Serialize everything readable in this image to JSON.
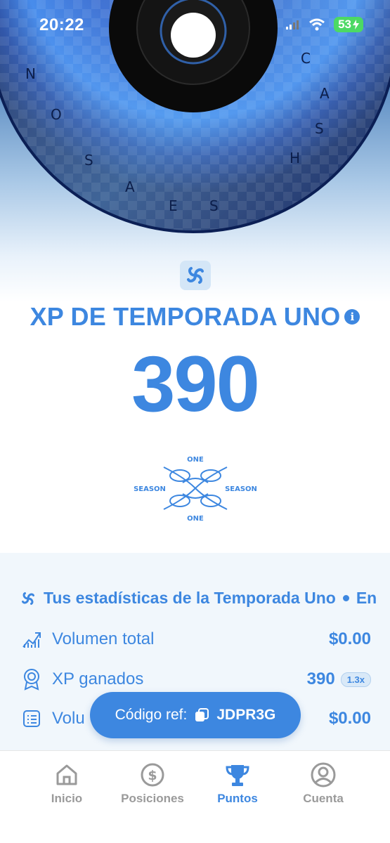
{
  "status_bar": {
    "time": "20:22",
    "battery": "53"
  },
  "disc": {
    "letters": [
      "C",
      "A",
      "S",
      "H",
      "S",
      "E",
      "A",
      "S",
      "O",
      "N"
    ]
  },
  "season": {
    "title": "XP DE TEMPORADA UNO",
    "xp_value": "390",
    "logo_words": {
      "top": "ONE",
      "bottom": "ONE",
      "left": "SEASON",
      "right": "SEASON"
    }
  },
  "stats": {
    "ticker_text": "Tus estadísticas de la Temporada Uno",
    "ticker_tail": "En",
    "rows": [
      {
        "label": "Volumen total",
        "value": "$0.00"
      },
      {
        "label": "XP ganados",
        "value": "390",
        "badge": "1.3x"
      },
      {
        "label": "Volu",
        "value": "$0.00"
      }
    ]
  },
  "referral": {
    "label": "Código ref:",
    "code": "JDPR3G"
  },
  "tabs": [
    {
      "label": "Inicio",
      "icon": "home-icon",
      "active": false
    },
    {
      "label": "Posiciones",
      "icon": "dollar-icon",
      "active": false
    },
    {
      "label": "Puntos",
      "icon": "trophy-icon",
      "active": true
    },
    {
      "label": "Cuenta",
      "icon": "user-icon",
      "active": false
    }
  ],
  "colors": {
    "accent": "#3d87e0",
    "inactive": "#9a9a9a",
    "panel": "#f1f7fc"
  }
}
